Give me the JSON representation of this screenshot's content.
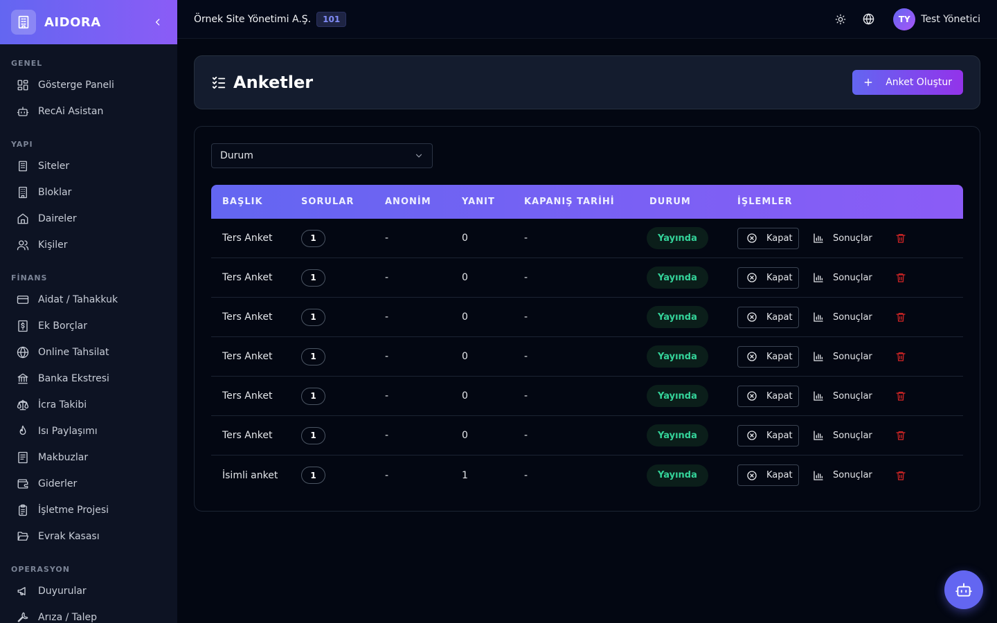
{
  "brand": {
    "name": "AIDORA"
  },
  "sidebar": {
    "sections": [
      {
        "label": "GENEL",
        "items": [
          {
            "label": "Gösterge Paneli",
            "icon": "dashboard-icon"
          },
          {
            "label": "RecAi Asistan",
            "icon": "bot-icon"
          }
        ]
      },
      {
        "label": "YAPI",
        "items": [
          {
            "label": "Siteler",
            "icon": "building-icon"
          },
          {
            "label": "Bloklar",
            "icon": "blocks-icon"
          },
          {
            "label": "Daireler",
            "icon": "home-icon"
          },
          {
            "label": "Kişiler",
            "icon": "users-icon"
          }
        ]
      },
      {
        "label": "FİNANS",
        "items": [
          {
            "label": "Aidat / Tahakkuk",
            "icon": "credit-card-icon"
          },
          {
            "label": "Ek Borçlar",
            "icon": "dollar-receipt-icon"
          },
          {
            "label": "Online Tahsilat",
            "icon": "globe-icon"
          },
          {
            "label": "Banka Ekstresi",
            "icon": "bank-icon"
          },
          {
            "label": "İcra Takibi",
            "icon": "scale-icon"
          },
          {
            "label": "Isı Paylaşımı",
            "icon": "flame-icon"
          },
          {
            "label": "Makbuzlar",
            "icon": "receipt-icon"
          },
          {
            "label": "Giderler",
            "icon": "wallet-icon"
          },
          {
            "label": "İşletme Projesi",
            "icon": "clipboard-icon"
          },
          {
            "label": "Evrak Kasası",
            "icon": "folder-open-icon"
          }
        ]
      },
      {
        "label": "OPERASYON",
        "items": [
          {
            "label": "Duyurular",
            "icon": "megaphone-icon"
          },
          {
            "label": "Arıza / Talep",
            "icon": "wrench-icon"
          }
        ]
      }
    ]
  },
  "topbar": {
    "org_name": "Örnek Site Yönetimi A.Ş.",
    "org_badge": "101",
    "user_initials": "TY",
    "user_name": "Test Yönetici"
  },
  "page": {
    "title": "Anketler",
    "create_button": "Anket Oluştur"
  },
  "filter": {
    "status_label": "Durum"
  },
  "table": {
    "headers": [
      "BAŞLIK",
      "SORULAR",
      "ANONİM",
      "YANIT",
      "KAPANIŞ TARİHİ",
      "DURUM",
      "İŞLEMLER"
    ],
    "close_label": "Kapat",
    "results_label": "Sonuçlar",
    "rows": [
      {
        "title": "Ters Anket",
        "questions": "1",
        "anonymous": "-",
        "responses": "0",
        "close_date": "-",
        "status": "Yayında"
      },
      {
        "title": "Ters Anket",
        "questions": "1",
        "anonymous": "-",
        "responses": "0",
        "close_date": "-",
        "status": "Yayında"
      },
      {
        "title": "Ters Anket",
        "questions": "1",
        "anonymous": "-",
        "responses": "0",
        "close_date": "-",
        "status": "Yayında"
      },
      {
        "title": "Ters Anket",
        "questions": "1",
        "anonymous": "-",
        "responses": "0",
        "close_date": "-",
        "status": "Yayında"
      },
      {
        "title": "Ters Anket",
        "questions": "1",
        "anonymous": "-",
        "responses": "0",
        "close_date": "-",
        "status": "Yayında"
      },
      {
        "title": "Ters Anket",
        "questions": "1",
        "anonymous": "-",
        "responses": "0",
        "close_date": "-",
        "status": "Yayında"
      },
      {
        "title": "İsimli anket",
        "questions": "1",
        "anonymous": "-",
        "responses": "1",
        "close_date": "-",
        "status": "Yayında"
      }
    ]
  },
  "colors": {
    "accent": "#6366f1",
    "accent_end": "#8b5cf6",
    "status_published": "#34d399",
    "danger": "#dc2626"
  }
}
